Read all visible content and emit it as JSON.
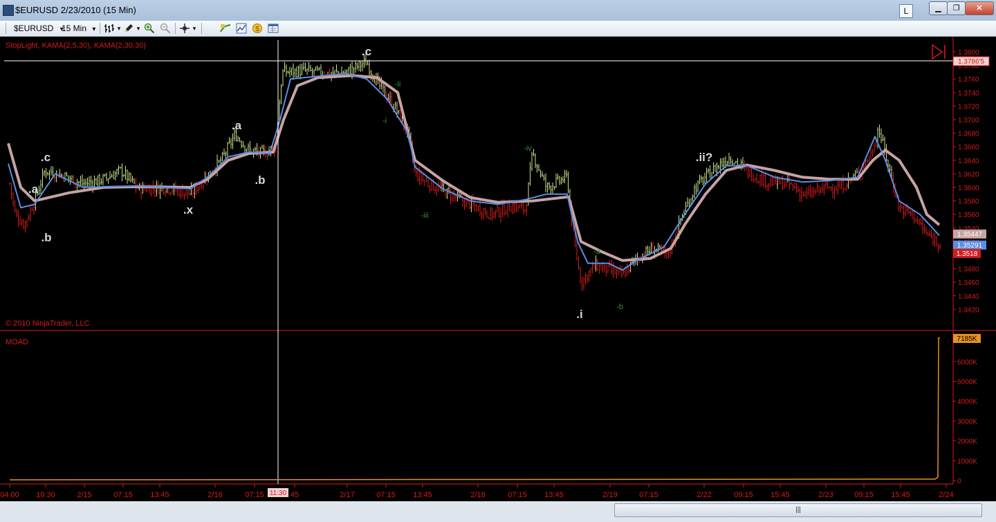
{
  "window": {
    "title": "$EURUSD  2/23/2010 (15 Min)",
    "l_button": "L",
    "minimize_label": "▁",
    "restore_label": "❐",
    "close_label": "✕"
  },
  "toolbar": {
    "instrument": "$EURUSD",
    "interval": "15 Min",
    "dropdown_arrow": "▾"
  },
  "indicator_label": "StopLight, KAMA(2,5,30), KAMA(2,30,30)",
  "copyright": "© 2010 NinjaTrader, LLC",
  "moad_label": "MOAD",
  "colors": {
    "axis": "#d71b1b",
    "bull": "#c8e68c",
    "bear": "#d71b1b",
    "neutral": "#e6d28c",
    "kama_fast": "#5a8ee6",
    "kama_slow": "#c7a3a3",
    "volume": "#e6921e",
    "crosshair": "#ffffff"
  },
  "price_axis": {
    "ticks": [
      "1.3800",
      "1.3780",
      "1.3760",
      "1.3740",
      "1.3720",
      "1.3700",
      "1.3680",
      "1.3660",
      "1.3640",
      "1.3620",
      "1.3600",
      "1.3580",
      "1.3560",
      "1.3540",
      "1.3520",
      "1.3500",
      "1.3480",
      "1.3460",
      "1.3440",
      "1.3420"
    ],
    "crosshair_price": "1.3786'5",
    "kama_slow_value": "1.35447",
    "kama_fast_value": "1.35291",
    "last_price": "1.3518"
  },
  "volume_axis": {
    "ticks": [
      "0",
      "1000K",
      "2000K",
      "3000K",
      "4000K",
      "5000K",
      "6000K"
    ],
    "last_value": "7185K"
  },
  "time_axis": {
    "labels": [
      "04:00",
      "10:30",
      "2/15",
      "07:15",
      "13:45",
      "2/16",
      "07:15",
      "45",
      "2/17",
      "07:15",
      "13:45",
      "2/18",
      "07:15",
      "13:45",
      "2/19",
      "07:15",
      "2/22",
      "09:15",
      "15:45",
      "2/23",
      "09:15",
      "15:45",
      "2/24"
    ],
    "crosshair_time": "11:30"
  },
  "wave_labels": [
    {
      "text": ".a",
      "color": "#d8d8d8"
    },
    {
      "text": ".c",
      "color": "#d8d8d8"
    },
    {
      "text": ".b",
      "color": "#d8d8d8"
    },
    {
      "text": ".x",
      "color": "#d8d8d8"
    },
    {
      "text": ".a",
      "color": "#d8d8d8"
    },
    {
      "text": ".b",
      "color": "#d8d8d8"
    },
    {
      "text": ".c",
      "color": "#d8d8d8"
    },
    {
      "text": "-ii",
      "color": "#2e9a2e"
    },
    {
      "text": "-i",
      "color": "#2e9a2e"
    },
    {
      "text": "-iii",
      "color": "#2e9a2e"
    },
    {
      "text": "-iv",
      "color": "#2e9a2e"
    },
    {
      "text": ".i",
      "color": "#d8d8d8"
    },
    {
      "text": "-a",
      "color": "#2e9a2e"
    },
    {
      "text": "-b",
      "color": "#2e9a2e"
    },
    {
      "text": ".ii?",
      "color": "#d8d8d8"
    }
  ],
  "chart_data": {
    "type": "bar",
    "subtype": "ohlc-price-bars",
    "instrument": "$EURUSD",
    "interval": "15 Min",
    "price_range": [
      1.3412,
      1.3808
    ],
    "price_path": [
      [
        0,
        1.3665
      ],
      [
        8,
        1.364
      ],
      [
        22,
        1.356
      ],
      [
        35,
        1.3545
      ],
      [
        50,
        1.358
      ],
      [
        65,
        1.3625
      ],
      [
        90,
        1.3618
      ],
      [
        120,
        1.3605
      ],
      [
        150,
        1.3612
      ],
      [
        175,
        1.3625
      ],
      [
        200,
        1.3598
      ],
      [
        240,
        1.36
      ],
      [
        275,
        1.359
      ],
      [
        300,
        1.3618
      ],
      [
        320,
        1.364
      ],
      [
        340,
        1.3678
      ],
      [
        360,
        1.3655
      ],
      [
        380,
        1.365
      ],
      [
        398,
        1.366
      ],
      [
        408,
        1.377
      ],
      [
        440,
        1.3772
      ],
      [
        470,
        1.3768
      ],
      [
        500,
        1.377
      ],
      [
        530,
        1.3785
      ],
      [
        545,
        1.3755
      ],
      [
        570,
        1.372
      ],
      [
        590,
        1.368
      ],
      [
        600,
        1.362
      ],
      [
        620,
        1.3605
      ],
      [
        650,
        1.359
      ],
      [
        680,
        1.3575
      ],
      [
        710,
        1.356
      ],
      [
        740,
        1.3572
      ],
      [
        760,
        1.3568
      ],
      [
        770,
        1.365
      ],
      [
        790,
        1.36
      ],
      [
        820,
        1.3615
      ],
      [
        830,
        1.352
      ],
      [
        840,
        1.346
      ],
      [
        860,
        1.3485
      ],
      [
        880,
        1.3478
      ],
      [
        900,
        1.347
      ],
      [
        920,
        1.3495
      ],
      [
        945,
        1.351
      ],
      [
        965,
        1.35
      ],
      [
        985,
        1.3555
      ],
      [
        1005,
        1.36
      ],
      [
        1030,
        1.3625
      ],
      [
        1055,
        1.3645
      ],
      [
        1085,
        1.362
      ],
      [
        1110,
        1.3608
      ],
      [
        1140,
        1.3605
      ],
      [
        1165,
        1.3588
      ],
      [
        1195,
        1.36
      ],
      [
        1215,
        1.36
      ],
      [
        1240,
        1.362
      ],
      [
        1260,
        1.365
      ],
      [
        1270,
        1.3688
      ],
      [
        1280,
        1.365
      ],
      [
        1300,
        1.357
      ],
      [
        1320,
        1.356
      ],
      [
        1340,
        1.353
      ],
      [
        1360,
        1.3518
      ]
    ],
    "kama_fast": [
      [
        12,
        1.3635
      ],
      [
        30,
        1.357
      ],
      [
        50,
        1.3575
      ],
      [
        80,
        1.362
      ],
      [
        120,
        1.36
      ],
      [
        200,
        1.3602
      ],
      [
        275,
        1.3598
      ],
      [
        300,
        1.3615
      ],
      [
        330,
        1.3645
      ],
      [
        360,
        1.3652
      ],
      [
        390,
        1.365
      ],
      [
        405,
        1.37
      ],
      [
        420,
        1.376
      ],
      [
        450,
        1.3763
      ],
      [
        500,
        1.3768
      ],
      [
        530,
        1.376
      ],
      [
        560,
        1.373
      ],
      [
        590,
        1.368
      ],
      [
        600,
        1.363
      ],
      [
        640,
        1.3598
      ],
      [
        680,
        1.358
      ],
      [
        720,
        1.3575
      ],
      [
        760,
        1.3582
      ],
      [
        790,
        1.359
      ],
      [
        820,
        1.359
      ],
      [
        835,
        1.352
      ],
      [
        850,
        1.3488
      ],
      [
        880,
        1.3488
      ],
      [
        900,
        1.3478
      ],
      [
        920,
        1.3492
      ],
      [
        960,
        1.3512
      ],
      [
        990,
        1.356
      ],
      [
        1020,
        1.3605
      ],
      [
        1050,
        1.3632
      ],
      [
        1080,
        1.3632
      ],
      [
        1120,
        1.3615
      ],
      [
        1160,
        1.3608
      ],
      [
        1200,
        1.361
      ],
      [
        1240,
        1.3615
      ],
      [
        1265,
        1.3675
      ],
      [
        1280,
        1.364
      ],
      [
        1300,
        1.358
      ],
      [
        1330,
        1.356
      ],
      [
        1358,
        1.3529
      ]
    ],
    "kama_slow": [
      [
        12,
        1.3665
      ],
      [
        30,
        1.36
      ],
      [
        50,
        1.358
      ],
      [
        100,
        1.3592
      ],
      [
        150,
        1.36
      ],
      [
        200,
        1.3601
      ],
      [
        275,
        1.36
      ],
      [
        300,
        1.3612
      ],
      [
        330,
        1.364
      ],
      [
        360,
        1.365
      ],
      [
        395,
        1.3652
      ],
      [
        410,
        1.37
      ],
      [
        430,
        1.375
      ],
      [
        460,
        1.3762
      ],
      [
        510,
        1.3765
      ],
      [
        545,
        1.3762
      ],
      [
        575,
        1.374
      ],
      [
        590,
        1.368
      ],
      [
        600,
        1.364
      ],
      [
        640,
        1.361
      ],
      [
        680,
        1.3585
      ],
      [
        720,
        1.3578
      ],
      [
        770,
        1.358
      ],
      [
        822,
        1.3586
      ],
      [
        840,
        1.352
      ],
      [
        870,
        1.3505
      ],
      [
        900,
        1.3492
      ],
      [
        940,
        1.3495
      ],
      [
        970,
        1.351
      ],
      [
        990,
        1.3545
      ],
      [
        1020,
        1.359
      ],
      [
        1050,
        1.3625
      ],
      [
        1080,
        1.3633
      ],
      [
        1120,
        1.3625
      ],
      [
        1160,
        1.3615
      ],
      [
        1200,
        1.3612
      ],
      [
        1240,
        1.3612
      ],
      [
        1262,
        1.364
      ],
      [
        1280,
        1.3655
      ],
      [
        1300,
        1.364
      ],
      [
        1325,
        1.36
      ],
      [
        1340,
        1.356
      ],
      [
        1358,
        1.35447
      ]
    ],
    "crosshair": {
      "time": "11:30",
      "price": "1.3786'5"
    },
    "last": {
      "price": 1.3518,
      "kama_fast": 1.35291,
      "kama_slow": 1.35447,
      "volume_k": 7185
    }
  }
}
